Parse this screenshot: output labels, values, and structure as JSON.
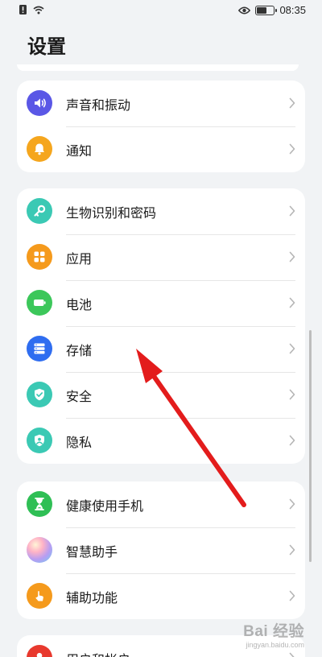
{
  "status_bar": {
    "time": "08:35",
    "battery_level": 0.6
  },
  "page": {
    "title": "设置"
  },
  "groups": [
    {
      "items": [
        {
          "label": "声音和振动",
          "icon": "speaker-icon",
          "color": "#5a57e6"
        },
        {
          "label": "通知",
          "icon": "bell-icon",
          "color": "#f5a61e"
        }
      ]
    },
    {
      "items": [
        {
          "label": "生物识别和密码",
          "icon": "key-icon",
          "color": "#3bc9b4"
        },
        {
          "label": "应用",
          "icon": "apps-grid-icon",
          "color": "#f59a1c"
        },
        {
          "label": "电池",
          "icon": "battery-icon",
          "color": "#3cc75a"
        },
        {
          "label": "存储",
          "icon": "storage-icon",
          "color": "#2f6df0"
        },
        {
          "label": "安全",
          "icon": "shield-check-icon",
          "color": "#3bc9b4"
        },
        {
          "label": "隐私",
          "icon": "privacy-shield-icon",
          "color": "#3bc9b4"
        }
      ]
    },
    {
      "items": [
        {
          "label": "健康使用手机",
          "icon": "hourglass-icon",
          "color": "#2fbf55"
        },
        {
          "label": "智慧助手",
          "icon": "assistant-orb-icon",
          "color": "#c69cf0"
        },
        {
          "label": "辅助功能",
          "icon": "hand-icon",
          "color": "#f59a1c"
        }
      ]
    },
    {
      "items": [
        {
          "label": "用户和帐户",
          "icon": "user-icon",
          "color": "#e8392e"
        }
      ]
    }
  ],
  "annotation": {
    "arrow_color": "#e31c1c"
  },
  "watermark": {
    "main": "Bai 经验",
    "sub": "jingyan.baidu.com"
  }
}
